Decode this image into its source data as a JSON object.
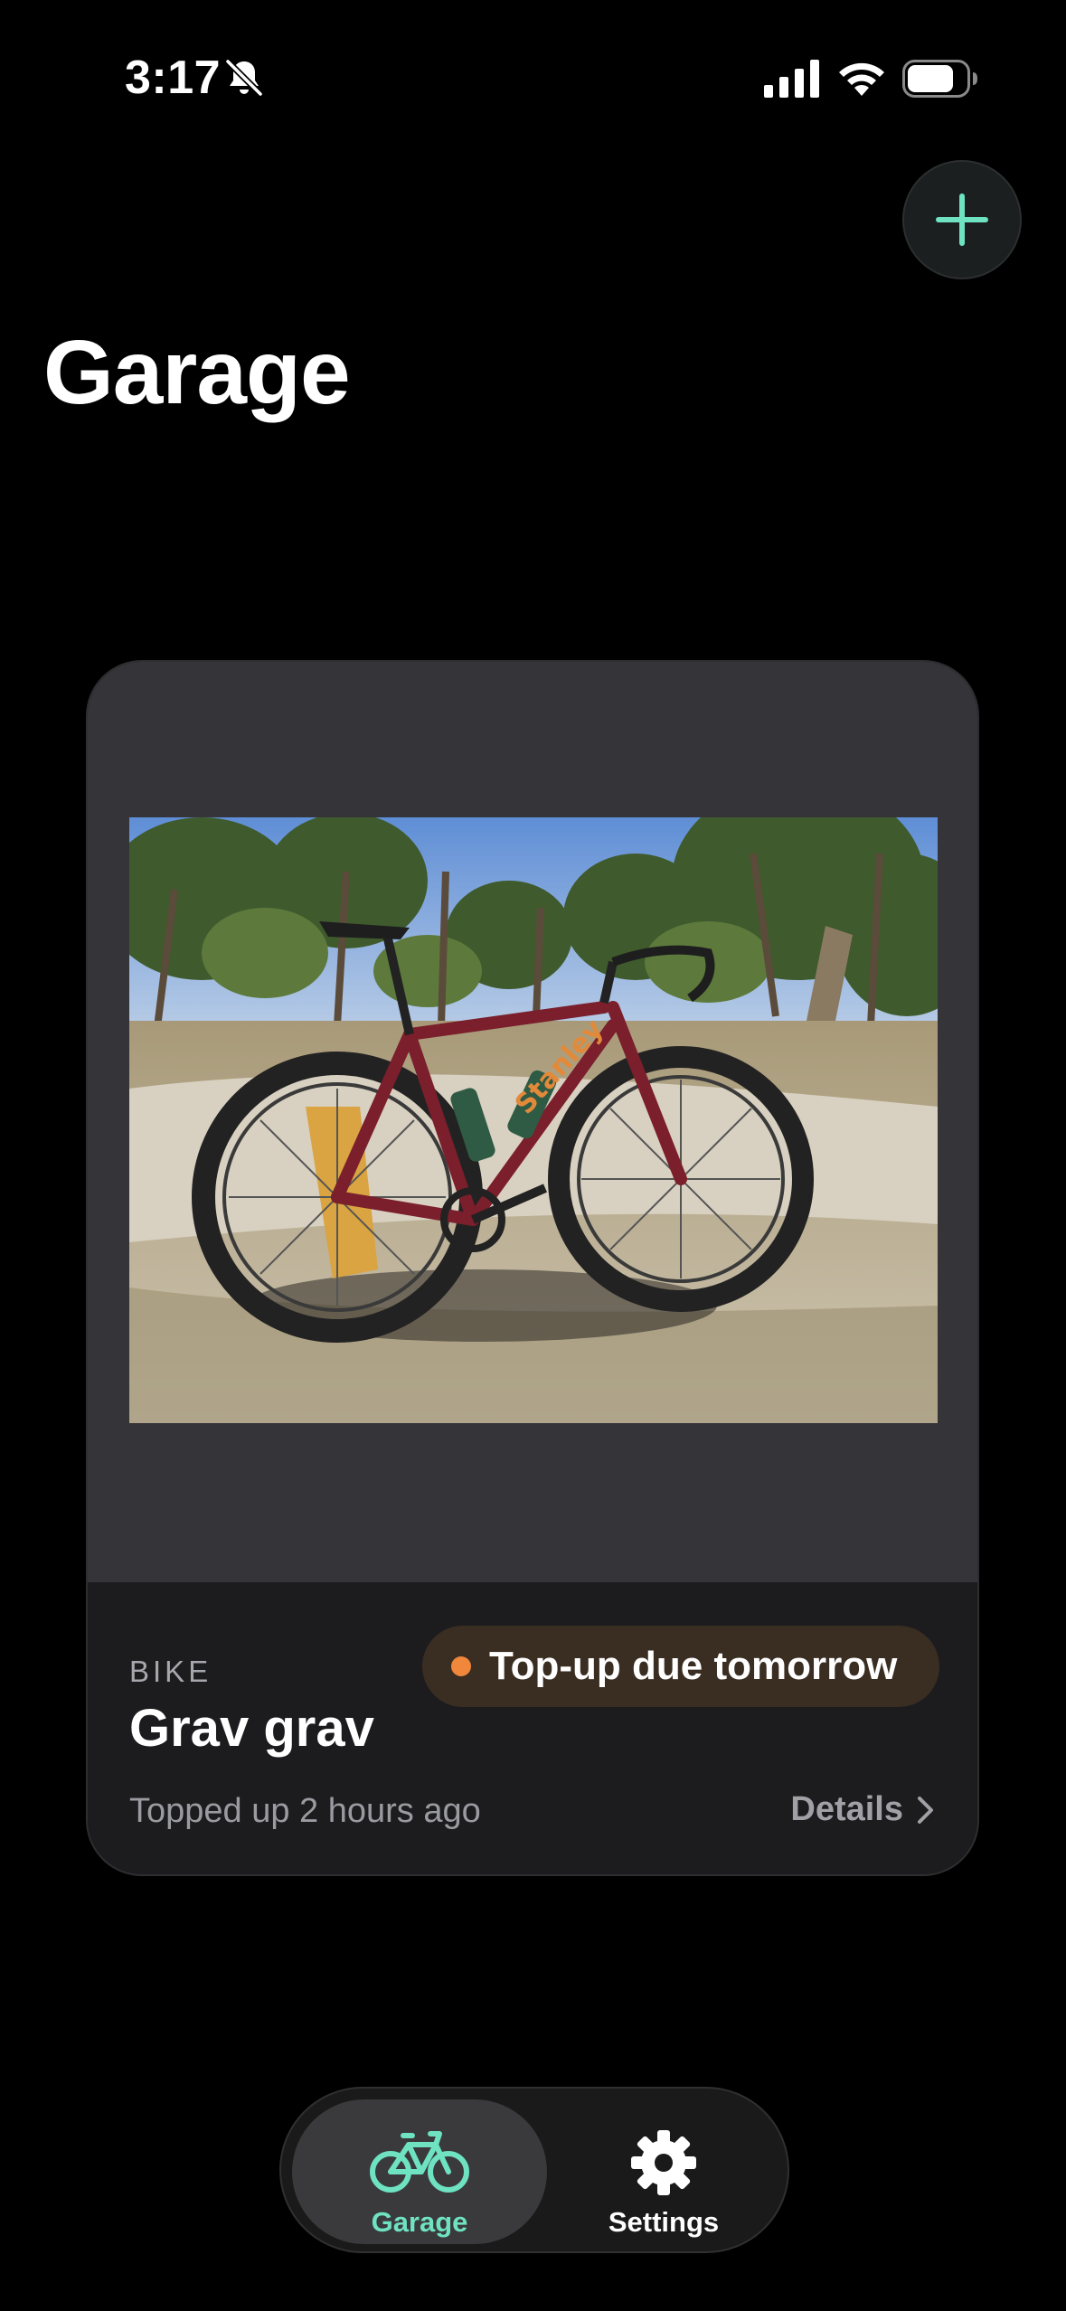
{
  "status_bar": {
    "time": "3:17",
    "icons": [
      "bell-off-icon",
      "cellular-signal-icon",
      "wifi-icon",
      "battery-icon"
    ]
  },
  "header": {
    "title": "Garage",
    "add_icon": "plus-icon"
  },
  "colors": {
    "accent": "#6ee2c1",
    "badge_dot": "#f0873a",
    "badge_bg": "#3a2d22",
    "card_bg": "#1c1c1e",
    "photo_area_bg": "#353439"
  },
  "bike_card": {
    "category": "BIKE",
    "name": "Grav grav",
    "badge": "Top-up due tomorrow",
    "status": "Topped up 2 hours ago",
    "details_label": "Details"
  },
  "tab_bar": {
    "items": [
      {
        "label": "Garage",
        "icon": "bicycle-icon",
        "selected": true
      },
      {
        "label": "Settings",
        "icon": "gear-icon",
        "selected": false
      }
    ]
  }
}
